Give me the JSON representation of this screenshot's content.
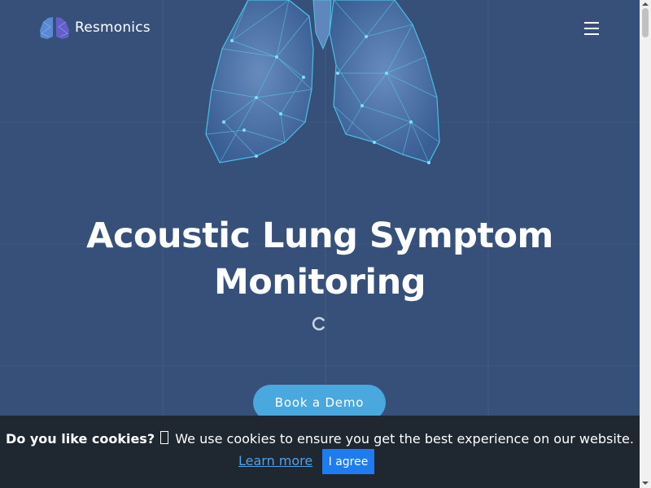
{
  "header": {
    "logo_icon": "lungs-logo-icon",
    "brand_name": "Resmonics",
    "menu_icon": "hamburger-menu-icon"
  },
  "hero": {
    "illustration": "polygon-lungs-illustration",
    "title": "Acoustic Lung Symptom Monitoring",
    "loading_icon": "loading-spinner-icon",
    "cta_label": "Book a Demo"
  },
  "cookie_banner": {
    "question": "Do you like cookies?",
    "cookie_icon": "cookie-icon",
    "message": "We use cookies to ensure you get the best experience on our website.",
    "learn_more_label": "Learn more",
    "agree_label": "I agree"
  },
  "colors": {
    "background": "#36507a",
    "cta_button": "#49a8de",
    "banner": "#1f2730",
    "agree_button": "#1e7cf0",
    "link": "#4fa2e8"
  }
}
